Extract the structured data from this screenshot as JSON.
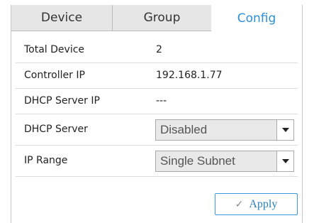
{
  "tabs": {
    "device": "Device",
    "group": "Group",
    "config": "Config",
    "active": "config"
  },
  "info": {
    "total_device_label": "Total Device",
    "total_device_value": "2",
    "controller_ip_label": "Controller IP",
    "controller_ip_value": "192.168.1.77",
    "dhcp_server_ip_label": "DHCP Server IP",
    "dhcp_server_ip_value": "---"
  },
  "settings": {
    "dhcp_server_label": "DHCP Server",
    "dhcp_server_selected": "Disabled",
    "ip_range_label": "IP Range",
    "ip_range_selected": "Single Subnet"
  },
  "actions": {
    "apply_icon": "check-icon",
    "apply_label": "Apply"
  },
  "colors": {
    "accent": "#2d8fd5",
    "tab_inactive_bg": "#e6e6e6",
    "select_bg": "#e9e9e9"
  }
}
